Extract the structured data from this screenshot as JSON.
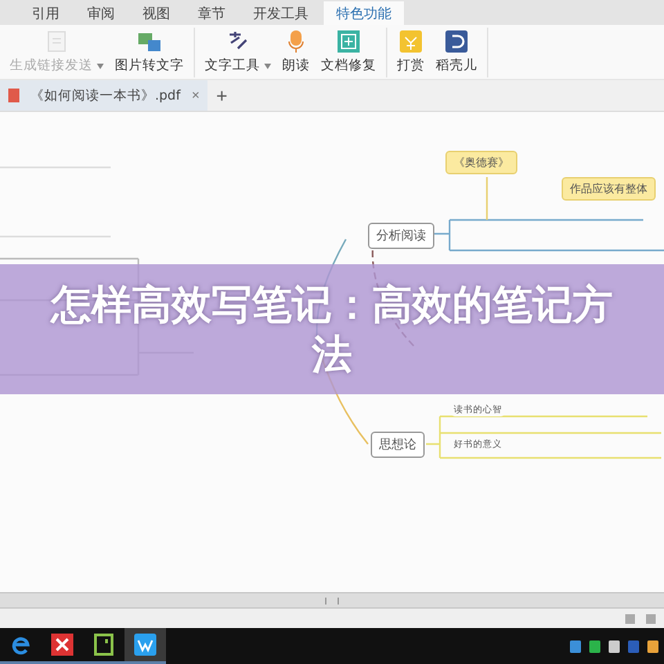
{
  "tabs": [
    {
      "label": "引用",
      "selected": false
    },
    {
      "label": "审阅",
      "selected": false
    },
    {
      "label": "视图",
      "selected": false
    },
    {
      "label": "章节",
      "selected": false
    },
    {
      "label": "开发工具",
      "selected": false
    },
    {
      "label": "特色功能",
      "selected": true
    }
  ],
  "ribbon": [
    {
      "label": "生成链接发送",
      "disabled": true,
      "dropdown": true
    },
    {
      "label": "图片转文字",
      "disabled": false,
      "dropdown": false
    },
    {
      "label": "文字工具",
      "disabled": false,
      "dropdown": true
    },
    {
      "label": "朗读",
      "disabled": false,
      "dropdown": false
    },
    {
      "label": "文档修复",
      "disabled": false,
      "dropdown": false
    },
    {
      "label": "打赏",
      "disabled": false,
      "dropdown": false
    },
    {
      "label": "稻壳儿",
      "disabled": false,
      "dropdown": false
    }
  ],
  "document_tab": {
    "title": "《如何阅读一本书》.pdf",
    "close": "×"
  },
  "new_tab": "+",
  "mind_map": {
    "nodes": [
      {
        "label": "《奥德赛》",
        "kind": "note"
      },
      {
        "label": "作品应该有整体",
        "kind": "note"
      },
      {
        "label": "分析阅读",
        "kind": "topic"
      },
      {
        "label": "思想论",
        "kind": "topic"
      },
      {
        "label": "读书的心智",
        "kind": "leaf"
      },
      {
        "label": "好书的意义",
        "kind": "leaf"
      }
    ]
  },
  "overlay_title": "怎样高效写笔记：高效的笔记方法",
  "taskbar": [
    {
      "selected": false
    },
    {
      "selected": false
    },
    {
      "selected": false
    },
    {
      "selected": true
    }
  ]
}
